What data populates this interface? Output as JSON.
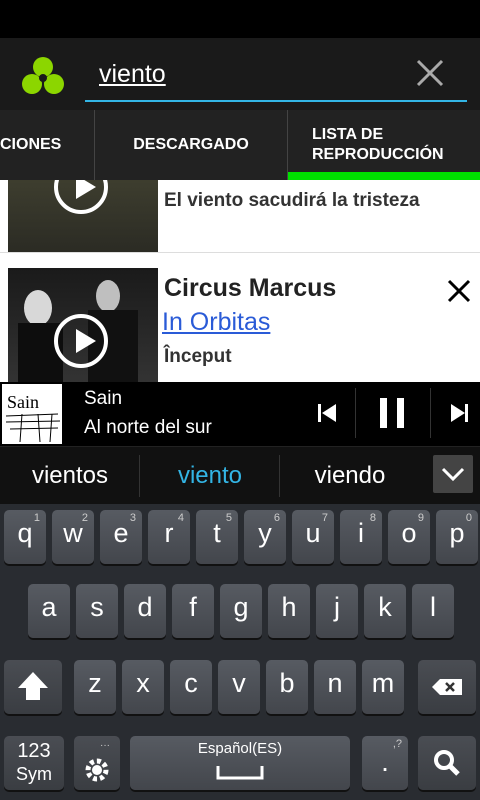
{
  "search": {
    "query": "viento"
  },
  "tabs": [
    {
      "label": "CIONES"
    },
    {
      "label": "DESCARGADO"
    },
    {
      "label_line1": "LISTA DE",
      "label_line2": "REPRODUCCIÓN",
      "active": true
    }
  ],
  "results": [
    {
      "subtitle": "El viento sacudirá la tristeza"
    },
    {
      "title": "Circus Marcus",
      "album": "In Orbitas",
      "artist": "Început"
    }
  ],
  "player": {
    "thumb_text": "Sain",
    "title": "Sain",
    "subtitle": "Al norte del sur"
  },
  "suggestions": [
    "vientos",
    "viento",
    "viendo"
  ],
  "keyboard": {
    "row1": [
      [
        "q",
        "1"
      ],
      [
        "w",
        "2"
      ],
      [
        "e",
        "3"
      ],
      [
        "r",
        "4"
      ],
      [
        "t",
        "5"
      ],
      [
        "y",
        "6"
      ],
      [
        "u",
        "7"
      ],
      [
        "i",
        "8"
      ],
      [
        "o",
        "9"
      ],
      [
        "p",
        "0"
      ]
    ],
    "row2": [
      "a",
      "s",
      "d",
      "f",
      "g",
      "h",
      "j",
      "k",
      "l"
    ],
    "row3": [
      "z",
      "x",
      "c",
      "v",
      "b",
      "n",
      "m"
    ],
    "sym_label1": "123",
    "sym_label2": "Sym",
    "space_label": "Español(ES)",
    "period_label": ".",
    "period_sub": ",?"
  },
  "colors": {
    "accent": "#33b5e5",
    "tab_indicator": "#00e000",
    "logo": "#8cd600",
    "link": "#2a5bd7"
  }
}
